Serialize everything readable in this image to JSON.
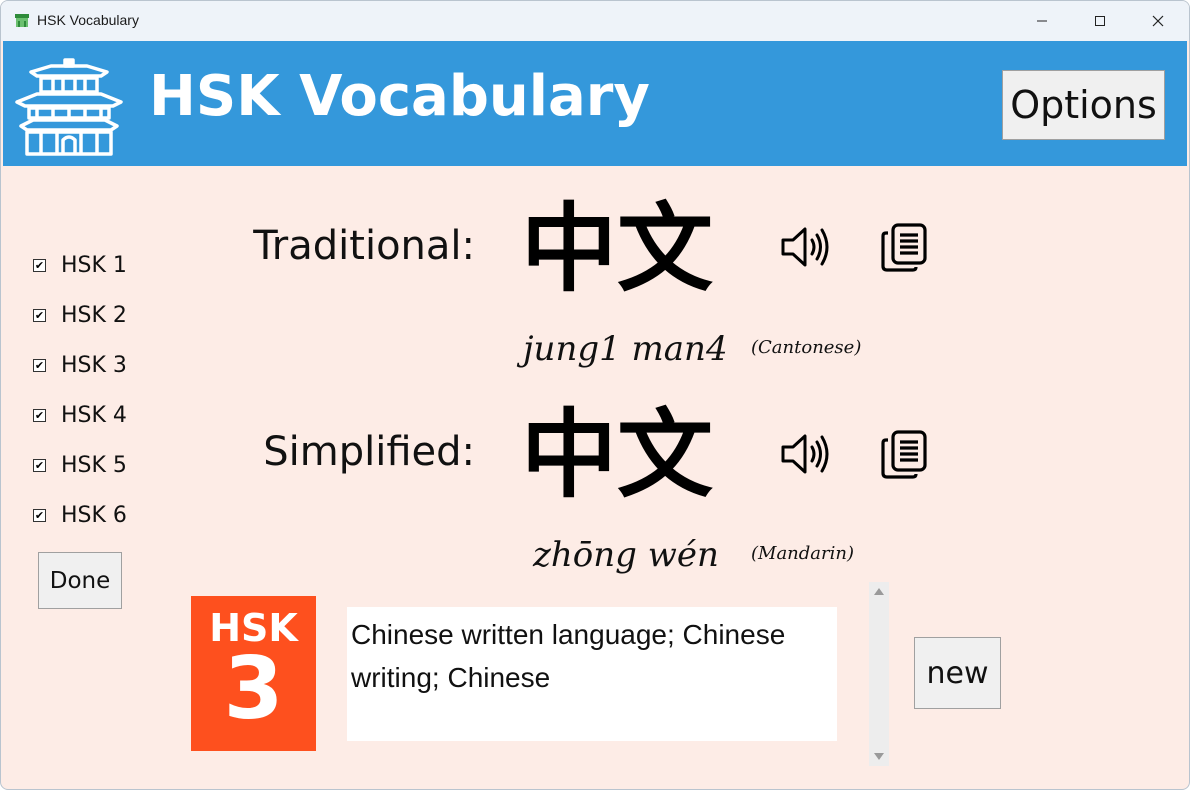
{
  "window": {
    "title": "HSK Vocabulary",
    "controls": [
      "minimize",
      "maximize",
      "close"
    ]
  },
  "header": {
    "title": "HSK Vocabulary",
    "logo_icon": "pagoda-icon",
    "options_label": "Options",
    "background_color": "#3498db"
  },
  "sidebar": {
    "levels": [
      {
        "label": "HSK 1",
        "checked": true
      },
      {
        "label": "HSK 2",
        "checked": true
      },
      {
        "label": "HSK 3",
        "checked": true
      },
      {
        "label": "HSK 4",
        "checked": true
      },
      {
        "label": "HSK 5",
        "checked": true
      },
      {
        "label": "HSK 6",
        "checked": true
      }
    ],
    "done_label": "Done"
  },
  "word": {
    "traditional_label": "Traditional:",
    "traditional": "中文",
    "cantonese_romanization": "jung1 man4",
    "cantonese_tag": "(Cantonese)",
    "simplified_label": "Simplified:",
    "simplified": "中文",
    "pinyin": "zhōng wén",
    "mandarin_tag": "(Mandarin)"
  },
  "badge": {
    "title": "HSK",
    "level": "3",
    "color": "#fe501e"
  },
  "definition": {
    "line1": "Chinese written language; Chinese",
    "line2": "writing; Chinese"
  },
  "actions": {
    "new_label": "new"
  },
  "colors": {
    "background": "#fdece6",
    "header": "#3498db",
    "badge": "#fe501e"
  }
}
